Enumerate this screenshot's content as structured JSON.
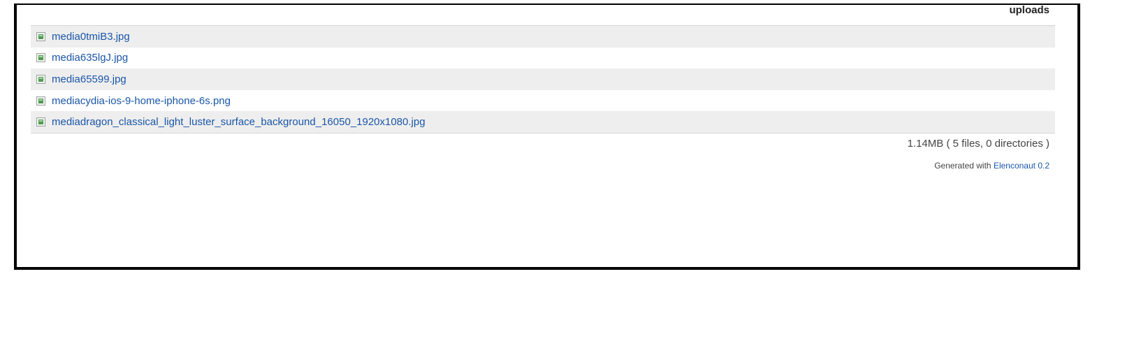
{
  "directory": {
    "title": "uploads"
  },
  "files": [
    {
      "name": "media0tmiB3.jpg",
      "icon": "image-file-icon"
    },
    {
      "name": "media635lgJ.jpg",
      "icon": "image-file-icon"
    },
    {
      "name": "media65599.jpg",
      "icon": "image-file-icon"
    },
    {
      "name": "mediacydia-ios-9-home-iphone-6s.png",
      "icon": "image-file-icon"
    },
    {
      "name": "mediadragon_classical_light_luster_surface_background_16050_1920x1080.jpg",
      "icon": "image-file-icon"
    }
  ],
  "summary": {
    "text": "1.14MB ( 5 files, 0 directories )"
  },
  "footer": {
    "generated_prefix": "Generated with",
    "generator_link": "Elenconaut 0.2"
  },
  "colors": {
    "link": "#1a56a8",
    "row_alt": "#eeeeee",
    "frame_border": "#000000"
  }
}
